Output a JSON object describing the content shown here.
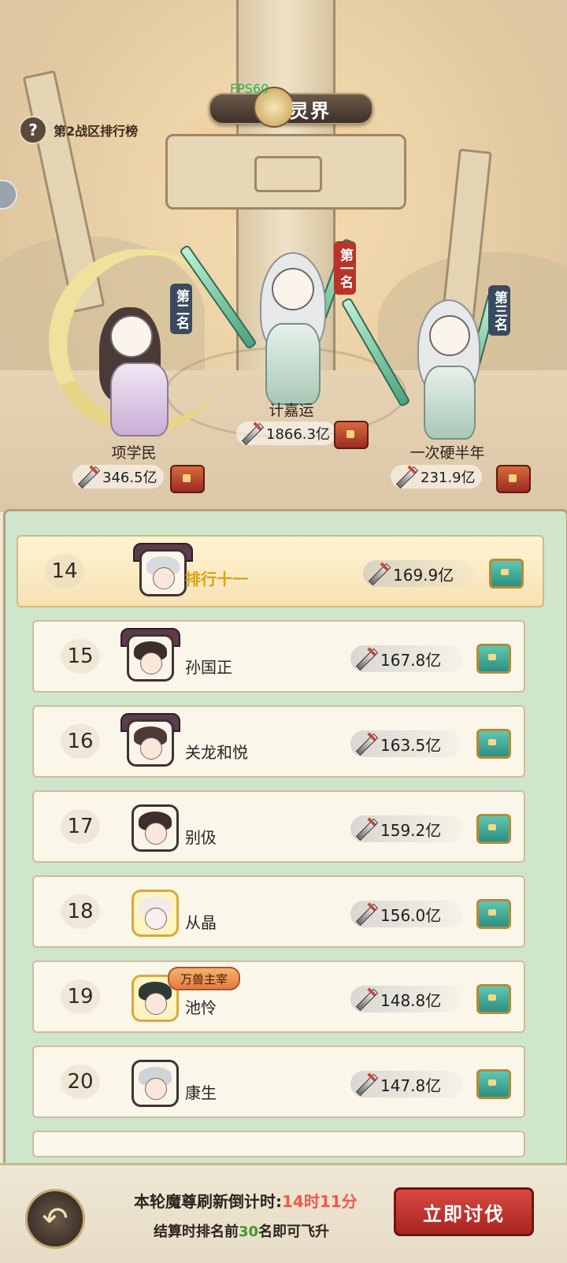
{
  "header": {
    "fps": "FPS60",
    "title": "灵界",
    "help_label": "第2战区排行榜"
  },
  "podium": {
    "first": {
      "rank_tag": "第一名",
      "name": "计嘉运",
      "power": "1866.3亿"
    },
    "second": {
      "rank_tag": "第二名",
      "name": "项学民",
      "power": "346.5亿"
    },
    "third": {
      "rank_tag": "第三名",
      "name": "一次硬半年",
      "power": "231.9亿"
    }
  },
  "rows": [
    {
      "rank": "14",
      "name": "排行十一",
      "power": "169.9亿",
      "self": true
    },
    {
      "rank": "15",
      "name": "孙国正",
      "power": "167.8亿"
    },
    {
      "rank": "16",
      "name": "关龙和悦",
      "power": "163.5亿"
    },
    {
      "rank": "17",
      "name": "别伋",
      "power": "159.2亿"
    },
    {
      "rank": "18",
      "name": "从晶",
      "power": "156.0亿"
    },
    {
      "rank": "19",
      "name": "池怜",
      "power": "148.8亿",
      "title_badge": "万兽主宰"
    },
    {
      "rank": "20",
      "name": "康生",
      "power": "147.8亿"
    }
  ],
  "footer": {
    "countdown_label": "本轮魔尊刷新倒计时:",
    "countdown_value": "14时11分",
    "rule_prefix": "结算时排名前",
    "rule_number": "30",
    "rule_suffix": "名即可飞升",
    "cta_label": "立即讨伐",
    "back_icon": "back-arrow-icon"
  },
  "colors": {
    "list_bg": "#cfe6cc",
    "highlight_name": "#d6a21a",
    "countdown_highlight": "#ee5a4a",
    "rule_highlight": "#3b9a2e",
    "cta_red": "#c7352f"
  }
}
